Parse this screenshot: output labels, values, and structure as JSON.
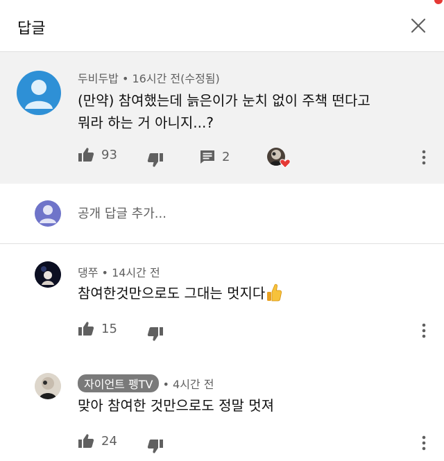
{
  "header": {
    "title": "답글"
  },
  "parent_comment": {
    "author": "두비두밥",
    "meta": " • 16시간 전(수정됨)",
    "text_line1": "(만약) 참여했는데 늙은이가 눈치 없이 주책 떤다고",
    "text_line2": "뭐라 하는 거 아니지...?",
    "likes": "93",
    "replies": "2"
  },
  "add_reply": {
    "placeholder": "공개 답글 추가..."
  },
  "replies": [
    {
      "author": "댕쭈",
      "meta": " • 14시간 전",
      "text": "참여한것만으로도 그대는 멋지다",
      "likes": "15"
    },
    {
      "author": "자이언트 펭TV",
      "meta": " • 4시간 전",
      "text": "맞아 참여한 것만으로도 정말 멋져",
      "likes": "24"
    }
  ],
  "colors": {
    "accent_blue": "#2e90d6",
    "heart_red": "#e53935",
    "panel_gray": "#f2f2f2",
    "meta_gray": "#606060"
  }
}
